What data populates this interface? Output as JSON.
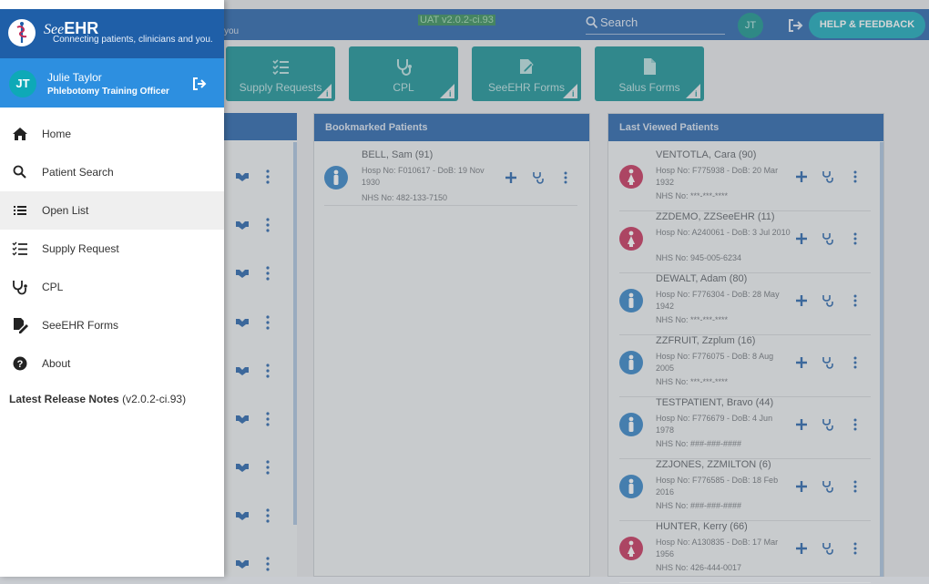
{
  "topbar": {
    "partial_text": "you",
    "version": "UAT v2.0.2-ci.93",
    "search_placeholder": "Search",
    "user_initials": "JT",
    "help_label": "HELP & FEEDBACK"
  },
  "tiles": [
    {
      "label": "Supply Requests",
      "icon": "checklist-icon"
    },
    {
      "label": "CPL",
      "icon": "stethoscope-icon"
    },
    {
      "label": "SeeEHR Forms",
      "icon": "form-edit-icon"
    },
    {
      "label": "Salus Forms",
      "icon": "document-icon"
    }
  ],
  "bookmarked": {
    "title": "Bookmarked Patients",
    "patients": [
      {
        "name": "BELL, Sam (91)",
        "hosp": "Hosp No: F010617 - DoB: 19 Nov 1930",
        "nhs": "NHS No: 482-133-7150",
        "gender": "male"
      }
    ]
  },
  "last_viewed": {
    "title": "Last Viewed Patients",
    "patients": [
      {
        "name": "VENTOTLA, Cara (90)",
        "hosp": "Hosp No: F775938 - DoB: 20 Mar 1932",
        "nhs": "NHS No: ***-***-****",
        "gender": "female"
      },
      {
        "name": "ZZDEMO, ZZSeeEHR (11)",
        "hosp": "Hosp No: A240061 - DoB: 3 Jul 2010",
        "nhs": "NHS No: 945-005-6234",
        "gender": "female"
      },
      {
        "name": "DEWALT, Adam (80)",
        "hosp": "Hosp No: F776304 - DoB: 28 May 1942",
        "nhs": "NHS No: ***-***-****",
        "gender": "male"
      },
      {
        "name": "ZZFRUIT, Zzplum (16)",
        "hosp": "Hosp No: F776075 - DoB: 8 Aug 2005",
        "nhs": "NHS No: ***-***-****",
        "gender": "male"
      },
      {
        "name": "TESTPATIENT, Bravo (44)",
        "hosp": "Hosp No: F776679 - DoB: 4 Jun 1978",
        "nhs": "NHS No: ###-###-####",
        "gender": "male"
      },
      {
        "name": "ZZJONES, ZZMILTON (6)",
        "hosp": "Hosp No: F776585 - DoB: 18 Feb 2016",
        "nhs": "NHS No: ###-###-####",
        "gender": "male"
      },
      {
        "name": "HUNTER, Kerry (66)",
        "hosp": "Hosp No: A130835 - DoB: 17 Mar 1956",
        "nhs": "NHS No: 426-444-0017",
        "gender": "female"
      }
    ]
  },
  "drawer": {
    "brand_see": "See",
    "brand_ehr": "EHR",
    "tagline": "Connecting patients, clinicians and you.",
    "user": {
      "initials": "JT",
      "name": "Julie Taylor",
      "role": "Phlebotomy Training Officer"
    },
    "menu": [
      {
        "label": "Home",
        "icon": "home-icon"
      },
      {
        "label": "Patient Search",
        "icon": "search-icon"
      },
      {
        "label": "Open List",
        "icon": "list-icon"
      },
      {
        "label": "Supply Request",
        "icon": "checklist-icon"
      },
      {
        "label": "CPL",
        "icon": "stethoscope-icon"
      },
      {
        "label": "SeeEHR Forms",
        "icon": "form-edit-icon"
      },
      {
        "label": "About",
        "icon": "help-circle-icon"
      }
    ],
    "release_label": "Latest Release Notes",
    "release_version": "(v2.0.2-ci.93)"
  },
  "colors": {
    "primary": "#1f5fa8",
    "accent": "#10a6b7",
    "tile": "#0f8e93",
    "male": "#2d7fc4",
    "female": "#c42b56"
  }
}
